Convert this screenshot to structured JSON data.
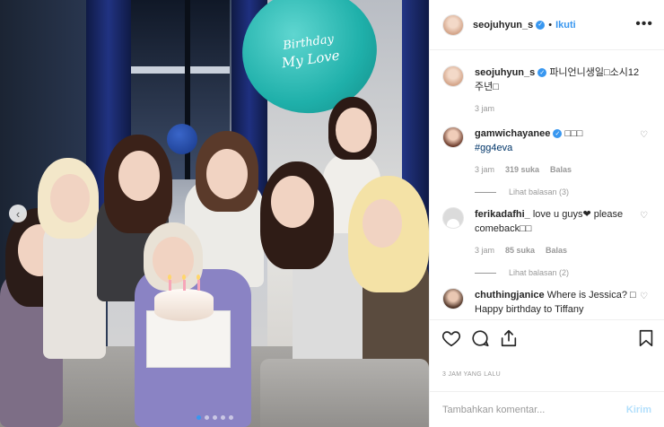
{
  "photo": {
    "balloon_text_1": "Birthday",
    "balloon_text_2": "My Love",
    "carousel_prev_glyph": "‹",
    "slide_count": 5,
    "active_slide": 1
  },
  "header": {
    "username": "seojuhyun_s",
    "verified_glyph": "✓",
    "separator": "•",
    "follow_label": "Ikuti",
    "more_glyph": "•••"
  },
  "caption": {
    "username": "seojuhyun_s",
    "text": "파니언니생일□소시12주년□",
    "time": "3 jam"
  },
  "comments": [
    {
      "username": "gamwichayanee",
      "verified": true,
      "text": "□□□",
      "hashtag": "#gg4eva",
      "time": "3 jam",
      "likes": "319 suka",
      "reply_label": "Balas",
      "view_replies": "Lihat balasan (3)"
    },
    {
      "username": "ferikadafhi_",
      "verified": false,
      "text": "love u guys❤ please comeback□□",
      "time": "3 jam",
      "likes": "85 suka",
      "reply_label": "Balas",
      "view_replies": "Lihat balasan (2)"
    },
    {
      "username": "chuthingjanice",
      "verified": false,
      "text": "Where is Jessica? □ Happy birthday to Tiffany"
    }
  ],
  "heart_glyph": "♡",
  "time_ago": "3 JAM YANG LALU",
  "add_comment": {
    "placeholder": "Tambahkan komentar...",
    "post_label": "Kirim"
  },
  "colors": {
    "accent": "#3897f0",
    "post_disabled": "#b2dffc",
    "muted": "#999999"
  }
}
